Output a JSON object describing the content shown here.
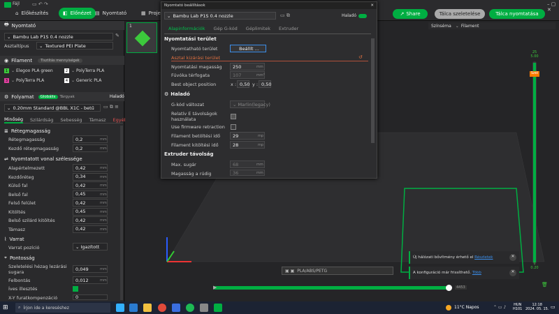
{
  "topbar": {
    "file_label": "Fájl",
    "tabs": [
      "Előkészítés",
      "Előnézet",
      "Nyomtató",
      "Projekt"
    ],
    "share": "Share",
    "slice_plate": "Tálca szeletelése",
    "print_plate": "Tálca nyomtatása"
  },
  "left": {
    "printer_header": "Nyomtató",
    "printer_name": "Bambu Lab P1S 0.4 nozzle",
    "plate_label": "Asztaltípus",
    "plate_value": "Textured PEI Plate",
    "filament_header": "Filament",
    "filament_badge": "Tisztítás mennyiségek",
    "filaments": [
      {
        "idx": "1",
        "name": "Elegoo PLA green",
        "color": "#3cc93c"
      },
      {
        "idx": "2",
        "name": "PolyTerra PLA",
        "color": "#ffffff"
      },
      {
        "idx": "3",
        "name": "PolyTerra PLA",
        "color": "#e040a0"
      },
      {
        "idx": "4",
        "name": "Generic PLA",
        "color": "#ffffff"
      }
    ],
    "process_header": "Folyamat",
    "process_global": "Globális",
    "process_objects": "Tárgyak",
    "process_advanced": "Haladó",
    "profile": "0.20mm Standard @BBL X1C - betű",
    "subtabs": [
      "Minőség",
      "Szilárdság",
      "Sebesség",
      "Támasz",
      "Egyéb"
    ],
    "layer_height_header": "Rétegmagasság",
    "layer_rows": [
      {
        "label": "Rétegmagasság",
        "value": "0,2",
        "unit": "mm"
      },
      {
        "label": "Kezdő rétegmagasság",
        "value": "0,2",
        "unit": "mm"
      }
    ],
    "line_width_header": "Nyomtatott vonal szélessége",
    "line_rows": [
      {
        "label": "Alapértelmezett",
        "value": "0,42",
        "unit": "mm"
      },
      {
        "label": "Kezdőréteg",
        "value": "0,34",
        "unit": "mm"
      },
      {
        "label": "Külső fal",
        "value": "0,42",
        "unit": "mm"
      },
      {
        "label": "Belső fal",
        "value": "0,45",
        "unit": "mm"
      },
      {
        "label": "Felső felület",
        "value": "0,42",
        "unit": "mm"
      },
      {
        "label": "Kitöltés",
        "value": "0,45",
        "unit": "mm"
      },
      {
        "label": "Belső szilárd kitöltés",
        "value": "0,42",
        "unit": "mm"
      },
      {
        "label": "Támasz",
        "value": "0,42",
        "unit": "mm"
      }
    ],
    "seam_header": "Varrat",
    "seam_label": "Varrat pozíció",
    "seam_value": "Igazított",
    "precision_header": "Pontosság",
    "precision_rows": [
      {
        "label": "Szeletelési hézag lezárási sugara",
        "value": "0,049",
        "unit": "mm"
      },
      {
        "label": "Felbontás",
        "value": "0,012",
        "unit": "mm"
      },
      {
        "label": "Íves illesztés",
        "value": "",
        "unit": ""
      },
      {
        "label": "X-Y furatkompenzáció",
        "value": "0",
        "unit": "mm"
      }
    ]
  },
  "dialog": {
    "title": "Nyomtató beállítások",
    "preset": "Bambu Lab P1S 0.4 nozzle",
    "advanced": "Haladó",
    "tabs": [
      "Alapinformációk",
      "Gép G-kód",
      "Géplimitek",
      "Extruder"
    ],
    "printable_area_header": "Nyomtatási terület",
    "printable_area": "Nyomtatható terület",
    "setup_button": "Beállít ...",
    "excluded": "Asztal kizárási terület",
    "max_height": "Nyomtatási magasság",
    "max_height_val": "250",
    "max_height_unit": "mm",
    "nozzle_volume": "Fúvóka térfogata",
    "nozzle_volume_val": "107",
    "nozzle_volume_unit": "mm³",
    "best_pos": "Best object position",
    "best_x_label": "x :",
    "best_x": "0,50",
    "best_y_label": "y :",
    "best_y": "0,50",
    "advanced_header": "Haladó",
    "gcode_flavor": "G-kód változat",
    "gcode_flavor_val": "Marlin(legacy)",
    "relative_e": "Relatív E távolságok használata",
    "fw_retract": "Use firmware retraction",
    "fil_load": "Filament betöltési idő",
    "fil_load_val": "29",
    "fil_unload": "Filament kitöltési idő",
    "fil_unload_val": "28",
    "time_unit": "mp",
    "extruder_clearance": "Extruder távolság",
    "radius": "Max. sugár",
    "radius_val": "68",
    "radius_unit": "mm",
    "height_rod": "Magasság a rúdig",
    "height_rod_val": "36",
    "height_rod_unit": "mm"
  },
  "viewport": {
    "theme_label": "Színséma",
    "theme_value": "Filament",
    "plate_number": "1",
    "plate_label": "PLA/ABS/PETG",
    "top_layer": "25",
    "top_layer_height": "5.00",
    "bottom_layer": "1",
    "bottom_layer_height": "0.20",
    "slider_tag": "Szél",
    "hslider_value": "4453",
    "notif1": "Új hálózati bővítmény érhető el",
    "notif1_link": "Részletek",
    "notif2": "A konfiguráció már frissíthető.",
    "notif2_link": "Több"
  },
  "taskbar": {
    "search": "Írjon ide a kereséshez",
    "weather": "11°C  Napos",
    "lang": "HUN",
    "kbd": "H101",
    "time": "12:18",
    "date": "2024. 05. 15."
  }
}
